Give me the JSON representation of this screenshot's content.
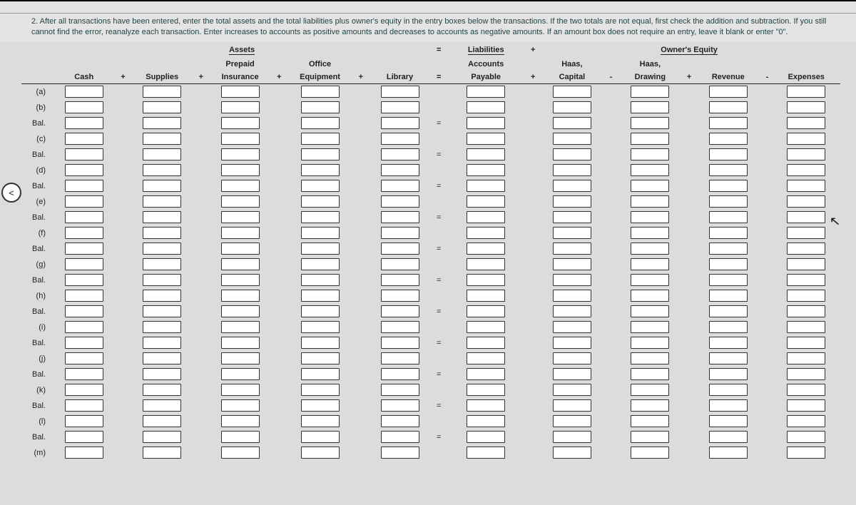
{
  "instructions": "2. After all transactions have been entered, enter the total assets and the total liabilities plus owner's equity in the entry boxes below the transactions. If the two totals are not equal, first check the addition and subtraction. If you still cannot find the error, reanalyze each transaction. Enter increases to accounts as positive amounts and decreases to accounts as negative amounts. If an amount box does not require an entry, leave it blank or enter \"0\".",
  "nav_prev": "<",
  "sections": {
    "assets": "Assets",
    "liabilities": "Liabilities",
    "owners_equity": "Owner's Equity"
  },
  "subheaders": {
    "prepaid": "Prepaid",
    "office": "Office",
    "accounts": "Accounts",
    "haas1": "Haas,",
    "haas2": "Haas,"
  },
  "columns": {
    "cash": "Cash",
    "supplies": "Supplies",
    "insurance": "Insurance",
    "equipment": "Equipment",
    "library": "Library",
    "payable": "Payable",
    "capital": "Capital",
    "drawing": "Drawing",
    "revenue": "Revenue",
    "expenses": "Expenses"
  },
  "ops": {
    "plus": "+",
    "minus": "-",
    "eq": "="
  },
  "rows": [
    "(a)",
    "(b)",
    "Bal.",
    "(c)",
    "Bal.",
    "(d)",
    "Bal.",
    "(e)",
    "Bal.",
    "(f)",
    "Bal.",
    "(g)",
    "Bal.",
    "(h)",
    "Bal.",
    "(i)",
    "Bal.",
    "(j)",
    "Bal.",
    "(k)",
    "Bal.",
    "(l)",
    "Bal.",
    "(m)"
  ],
  "row_eq": {
    "0": "",
    "1": "",
    "2": "=",
    "3": "",
    "4": "=",
    "5": "",
    "6": "=",
    "7": "",
    "8": "=",
    "9": "",
    "10": "=",
    "11": "",
    "12": "=",
    "13": "",
    "14": "=",
    "15": "",
    "16": "=",
    "17": "",
    "18": "=",
    "19": "",
    "20": "=",
    "21": "",
    "22": "=",
    "23": ""
  }
}
